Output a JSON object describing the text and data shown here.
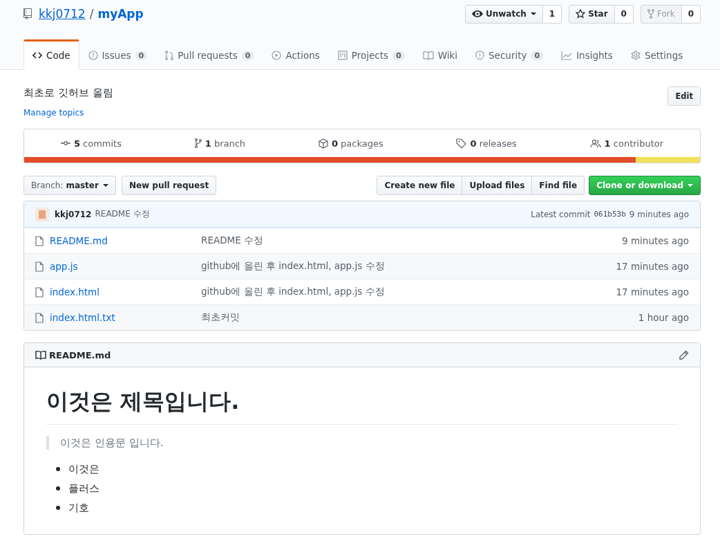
{
  "repo": {
    "owner": "kkj0712",
    "separator": "/",
    "name": "myApp"
  },
  "actions": [
    {
      "kind": "watch",
      "label": "Unwatch",
      "count": "1",
      "disabled": false
    },
    {
      "kind": "star",
      "label": "Star",
      "count": "0",
      "disabled": false
    },
    {
      "kind": "fork",
      "label": "Fork",
      "count": "0",
      "disabled": true
    }
  ],
  "tabs": [
    {
      "kind": "code",
      "label": "Code",
      "selected": true
    },
    {
      "kind": "issues",
      "label": "Issues",
      "count": "0",
      "selected": false
    },
    {
      "kind": "pulls",
      "label": "Pull requests",
      "count": "0",
      "selected": false
    },
    {
      "kind": "actions",
      "label": "Actions",
      "selected": false
    },
    {
      "kind": "projects",
      "label": "Projects",
      "count": "0",
      "selected": false
    },
    {
      "kind": "wiki",
      "label": "Wiki",
      "selected": false
    },
    {
      "kind": "security",
      "label": "Security",
      "count": "0",
      "selected": false
    },
    {
      "kind": "insights",
      "label": "Insights",
      "selected": false
    },
    {
      "kind": "settings",
      "label": "Settings",
      "selected": false
    }
  ],
  "description": "최초로 깃허브 올림",
  "edit_button": "Edit",
  "manage_topics": "Manage topics",
  "summary": [
    {
      "kind": "commits",
      "number": "5",
      "label": "commits"
    },
    {
      "kind": "branch",
      "number": "1",
      "label": "branch"
    },
    {
      "kind": "packages",
      "number": "0",
      "label": "packages"
    },
    {
      "kind": "releases",
      "number": "0",
      "label": "releases"
    },
    {
      "kind": "contributor",
      "number": "1",
      "label": "contributor"
    }
  ],
  "languages": [
    {
      "color": "#e34c26",
      "level": 0.905
    },
    {
      "color": "#f1e05a",
      "level": 0.095
    }
  ],
  "branch_select": {
    "prefix": "Branch:",
    "value": "master"
  },
  "new_pull_request": "New pull request",
  "file_buttons": [
    "Create new file",
    "Upload files",
    "Find file"
  ],
  "clone_button": "Clone or download",
  "latest_commit": {
    "author": "kkj0712",
    "message": "README 수정",
    "prefix": "Latest commit",
    "sha": "061b53b",
    "age": "9 minutes ago"
  },
  "files": [
    {
      "name": "README.md",
      "message": "README 수정",
      "age": "9 minutes ago"
    },
    {
      "name": "app.js",
      "message": "github에 올린 후 index.html, app.js 수정",
      "age": "17 minutes ago"
    },
    {
      "name": "index.html",
      "message": "github에 올린 후 index.html, app.js 수정",
      "age": "17 minutes ago"
    },
    {
      "name": "index.html.txt",
      "message": "최초커밋",
      "age": "1 hour ago"
    }
  ],
  "readme": {
    "filename": "README.md",
    "heading": "이것은 제목입니다.",
    "quote": "이것은 인용문 입니다.",
    "items": [
      "이것은",
      "플러스",
      "기호"
    ]
  }
}
